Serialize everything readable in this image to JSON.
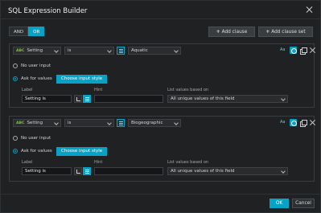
{
  "dialog": {
    "title": "SQL Expression Builder"
  },
  "toolbar": {
    "and_label": "AND",
    "or_label": "OR",
    "add_clause_label": "Add clause",
    "add_clause_set_label": "Add clause set"
  },
  "clauses": [
    {
      "field_type": "ABC",
      "field": "Setting",
      "operator": "is",
      "value": "Aquatic",
      "no_input_label": "No user input",
      "ask_label": "Ask for values",
      "choose_style_label": "Choose input style",
      "label_header": "Label",
      "hint_header": "Hint",
      "list_header": "List values based on",
      "label_value": "Setting is",
      "hint_value": "",
      "list_value": "All unique values of this field",
      "selected_mode": "ask"
    },
    {
      "field_type": "ABC",
      "field": "Setting",
      "operator": "is",
      "value": "Biogeographic",
      "no_input_label": "No user input",
      "ask_label": "Ask for values",
      "choose_style_label": "Choose input style",
      "label_header": "Label",
      "hint_header": "Hint",
      "list_header": "List values based on",
      "label_value": "Setting is",
      "hint_value": "",
      "list_value": "All unique values of this field",
      "selected_mode": "ask"
    }
  ],
  "footer": {
    "ok_label": "OK",
    "cancel_label": "Cancel"
  },
  "colors": {
    "accent": "#06a3c6",
    "dialog_bg": "#1f2123",
    "field_type_green": "#7fbf3f"
  }
}
